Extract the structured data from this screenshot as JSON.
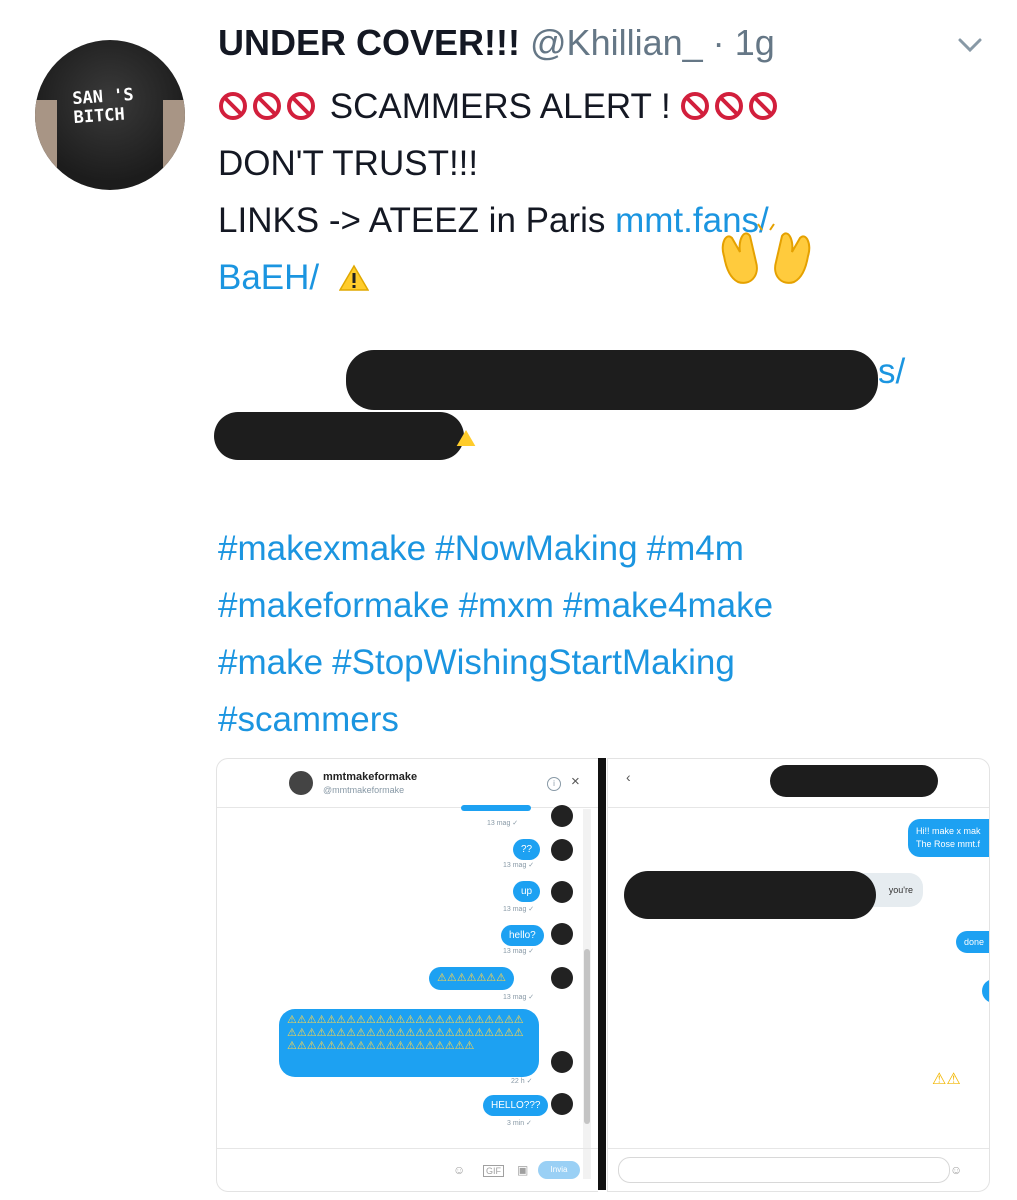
{
  "tweet": {
    "display_name": "UNDER COVER!!!",
    "handle": "@Khillian_",
    "separator": "·",
    "time": "1g",
    "avatar_shirt_text_line1": "SAN 'S",
    "avatar_shirt_text_line2": "BITCH",
    "alert_text": " SCAMMERS ALERT ! ",
    "line2": "DON'T TRUST!!!",
    "line3_prefix": "LINKS ->  ATEEZ in Paris ",
    "link1_part1": "mmt.fans/",
    "link1_part2": "BaEH/",
    "link2_visible_fragment": "s/",
    "hashtags": [
      "#makexmake",
      "#NowMaking",
      "#m4m",
      "#makeformake",
      "#mxm",
      "#make4make",
      "#make",
      "#StopWishingStartMaking",
      "#scammers"
    ],
    "icons": [
      "chevron-down-icon",
      "prohibited-icon",
      "warning-icon",
      "raised-hands-icon"
    ]
  },
  "left_screenshot": {
    "name": "mmtmakeformake",
    "username": "@mmtmakeformake",
    "info_label": "i",
    "close_label": "×",
    "messages": [
      {
        "text": "??",
        "stamp": "13 mag ✓"
      },
      {
        "text": "up",
        "stamp": "13 mag ✓"
      },
      {
        "text": "hello?",
        "stamp": "13 mag ✓"
      },
      {
        "text": "⚠⚠⚠⚠⚠⚠⚠",
        "stamp": "13 mag ✓"
      },
      {
        "text": "⚠⚠⚠⚠⚠⚠⚠⚠⚠⚠⚠⚠⚠⚠⚠⚠⚠⚠⚠⚠⚠⚠⚠⚠⚠⚠⚠⚠⚠⚠⚠⚠⚠⚠⚠⚠⚠⚠⚠⚠⚠⚠⚠⚠⚠⚠⚠⚠⚠⚠⚠⚠⚠⚠⚠⚠⚠⚠⚠⚠⚠⚠⚠⚠⚠⚠⚠",
        "stamp": "22 h ✓"
      },
      {
        "text": "HELLO???",
        "stamp": "3 min ✓"
      }
    ],
    "top_stamp": "13 mag ✓",
    "send_label": "Invia"
  },
  "right_screenshot": {
    "back_label": "‹",
    "msg1_line1": "Hi!! make x mak",
    "msg1_line2": "The Rose mmt.f",
    "grey_visible": "you're",
    "msg2": "done",
    "warnings": "⚠⚠"
  }
}
